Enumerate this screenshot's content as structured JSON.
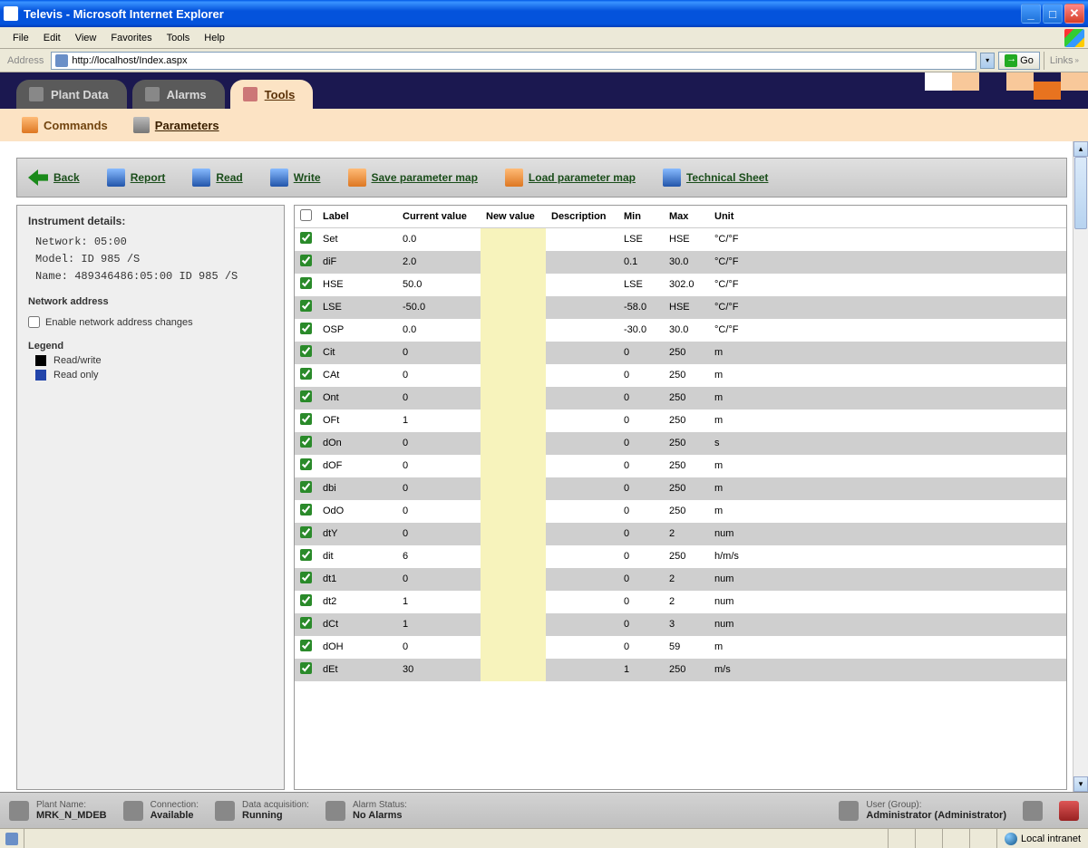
{
  "window": {
    "title": "Televis - Microsoft Internet Explorer"
  },
  "menu": {
    "file": "File",
    "edit": "Edit",
    "view": "View",
    "favorites": "Favorites",
    "tools": "Tools",
    "help": "Help"
  },
  "address": {
    "label": "Address",
    "url": "http://localhost/Index.aspx",
    "go": "Go",
    "links": "Links"
  },
  "tabs": {
    "plantdata": "Plant Data",
    "alarms": "Alarms",
    "tools": "Tools"
  },
  "subnav": {
    "commands": "Commands",
    "parameters": "Parameters"
  },
  "actions": {
    "back": "Back",
    "report": "Report",
    "read": "Read",
    "write": "Write",
    "savemap": "Save parameter map",
    "loadmap": "Load parameter map",
    "techsheet": "Technical Sheet"
  },
  "sidebar": {
    "detailsTitle": "Instrument details:",
    "networkLabel": "Network:",
    "networkVal": "05:00",
    "modelLabel": "Model:",
    "modelVal": "ID 985 /S",
    "nameLabel": "Name:",
    "nameVal": "489346486:05:00 ID 985 /S",
    "netAddr": "Network address",
    "enableChanges": "Enable network address changes",
    "legend": "Legend",
    "readwrite": "Read/write",
    "readonly": "Read only"
  },
  "tableHeaders": {
    "label": "Label",
    "current": "Current value",
    "new": "New value",
    "desc": "Description",
    "min": "Min",
    "max": "Max",
    "unit": "Unit"
  },
  "rows": [
    {
      "label": "Set",
      "cur": "0.0",
      "min": "LSE",
      "max": "HSE",
      "unit": "°C/°F"
    },
    {
      "label": "diF",
      "cur": "2.0",
      "min": "0.1",
      "max": "30.0",
      "unit": "°C/°F"
    },
    {
      "label": "HSE",
      "cur": "50.0",
      "min": "LSE",
      "max": "302.0",
      "unit": "°C/°F"
    },
    {
      "label": "LSE",
      "cur": "-50.0",
      "min": "-58.0",
      "max": "HSE",
      "unit": "°C/°F"
    },
    {
      "label": "OSP",
      "cur": "0.0",
      "min": "-30.0",
      "max": "30.0",
      "unit": "°C/°F"
    },
    {
      "label": "Cit",
      "cur": "0",
      "min": "0",
      "max": "250",
      "unit": "m"
    },
    {
      "label": "CAt",
      "cur": "0",
      "min": "0",
      "max": "250",
      "unit": "m"
    },
    {
      "label": "Ont",
      "cur": "0",
      "min": "0",
      "max": "250",
      "unit": "m"
    },
    {
      "label": "OFt",
      "cur": "1",
      "min": "0",
      "max": "250",
      "unit": "m"
    },
    {
      "label": "dOn",
      "cur": "0",
      "min": "0",
      "max": "250",
      "unit": "s"
    },
    {
      "label": "dOF",
      "cur": "0",
      "min": "0",
      "max": "250",
      "unit": "m"
    },
    {
      "label": "dbi",
      "cur": "0",
      "min": "0",
      "max": "250",
      "unit": "m"
    },
    {
      "label": "OdO",
      "cur": "0",
      "min": "0",
      "max": "250",
      "unit": "m"
    },
    {
      "label": "dtY",
      "cur": "0",
      "min": "0",
      "max": "2",
      "unit": "num"
    },
    {
      "label": "dit",
      "cur": "6",
      "min": "0",
      "max": "250",
      "unit": "h/m/s"
    },
    {
      "label": "dt1",
      "cur": "0",
      "min": "0",
      "max": "2",
      "unit": "num"
    },
    {
      "label": "dt2",
      "cur": "1",
      "min": "0",
      "max": "2",
      "unit": "num"
    },
    {
      "label": "dCt",
      "cur": "1",
      "min": "0",
      "max": "3",
      "unit": "num"
    },
    {
      "label": "dOH",
      "cur": "0",
      "min": "0",
      "max": "59",
      "unit": "m"
    },
    {
      "label": "dEt",
      "cur": "30",
      "min": "1",
      "max": "250",
      "unit": "m/s"
    }
  ],
  "statusbar": {
    "plantNameLbl": "Plant Name:",
    "plantNameVal": "MRK_N_MDEB",
    "connLbl": "Connection:",
    "connVal": "Available",
    "dataLbl": "Data acquisition:",
    "dataVal": "Running",
    "alarmLbl": "Alarm Status:",
    "alarmVal": "No Alarms",
    "userLbl": "User (Group):",
    "userVal": "Administrator (Administrator)"
  },
  "iestatus": {
    "zone": "Local intranet"
  }
}
